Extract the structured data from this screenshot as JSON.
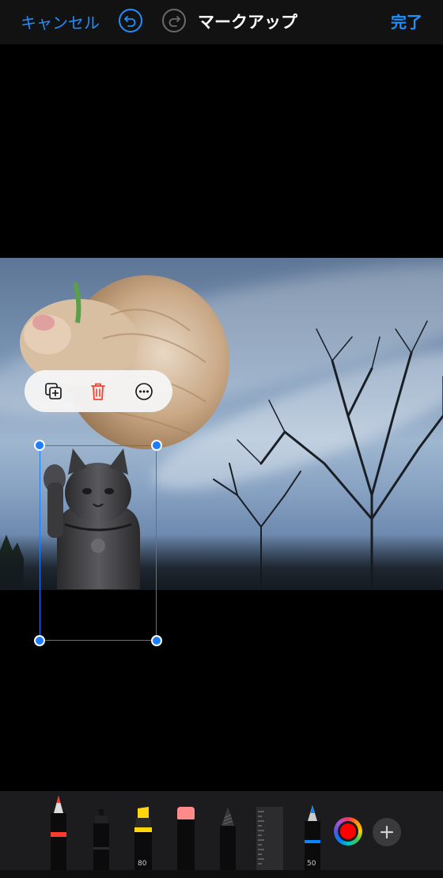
{
  "nav": {
    "cancel_label": "キャンセル",
    "title": "マークアップ",
    "done_label": "完了",
    "accent_color": "#1e90ff"
  },
  "icons": {
    "undo": "undo-icon",
    "redo": "redo-icon",
    "duplicate": "duplicate-icon",
    "delete": "trash-icon",
    "more": "more-icon",
    "add": "plus-icon"
  },
  "toolbar": {
    "tools": [
      {
        "name": "pen",
        "color": "#ff3b30"
      },
      {
        "name": "monoline",
        "color": "#111111"
      },
      {
        "name": "highlighter",
        "color": "#ffd60a",
        "size_label": "80"
      },
      {
        "name": "eraser",
        "color": "#ff8a8a"
      },
      {
        "name": "pencil",
        "color": "#222222"
      },
      {
        "name": "ruler",
        "color": "#555555"
      },
      {
        "name": "fountain-pen",
        "color": "#0a84ff",
        "size_label": "50"
      }
    ],
    "selected_color": "#ff0000"
  }
}
